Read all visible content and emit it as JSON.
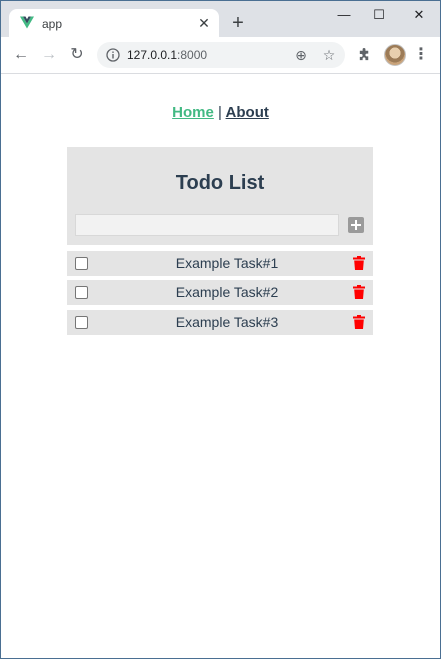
{
  "browser": {
    "tab_title": "app",
    "url_host": "127.0.0.1",
    "url_port": ":8000"
  },
  "nav": {
    "home": "Home",
    "separator": "|",
    "about": "About"
  },
  "todo": {
    "title": "Todo List",
    "input_value": "",
    "tasks": [
      {
        "label": "Example Task#1",
        "done": false
      },
      {
        "label": "Example Task#2",
        "done": false
      },
      {
        "label": "Example Task#3",
        "done": false
      }
    ]
  },
  "colors": {
    "home_link": "#42b983",
    "text": "#2c3e50",
    "panel": "#e4e4e4",
    "delete_icon": "#ff0000",
    "add_button": "#9a9a9a"
  }
}
